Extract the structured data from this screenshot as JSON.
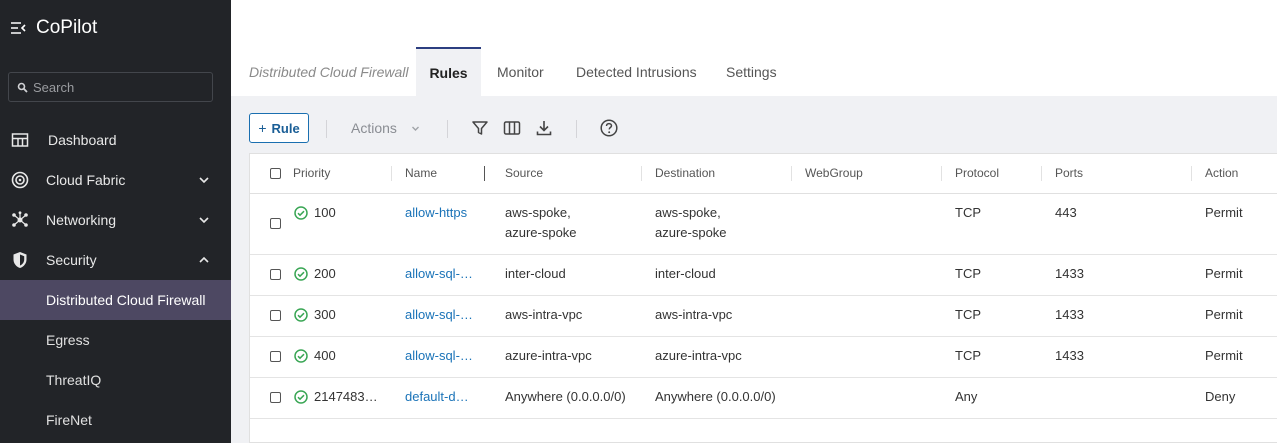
{
  "app": {
    "name": "CoPilot"
  },
  "search": {
    "placeholder": "Search"
  },
  "sidebar": {
    "items": [
      {
        "label": "Dashboard"
      },
      {
        "label": "Cloud Fabric"
      },
      {
        "label": "Networking"
      },
      {
        "label": "Security"
      }
    ],
    "security_sub": [
      {
        "label": "Distributed Cloud Firewall"
      },
      {
        "label": "Egress"
      },
      {
        "label": "ThreatIQ"
      },
      {
        "label": "FireNet"
      }
    ]
  },
  "tabs": {
    "breadcrumb": "Distributed Cloud Firewall",
    "items": [
      "Rules",
      "Monitor",
      "Detected Intrusions",
      "Settings"
    ],
    "active": "Rules"
  },
  "toolbar": {
    "rule_label": "Rule",
    "actions_label": "Actions",
    "icons": [
      "filter-icon",
      "columns-icon",
      "download-icon",
      "help-icon"
    ]
  },
  "table": {
    "headers": [
      "Priority",
      "Name",
      "Source",
      "Destination",
      "WebGroup",
      "Protocol",
      "Ports",
      "Action"
    ],
    "rows": [
      {
        "priority": "100",
        "name": "allow-https",
        "source": [
          "aws-spoke,",
          "azure-spoke"
        ],
        "destination": [
          "aws-spoke,",
          "azure-spoke"
        ],
        "webgroup": "",
        "protocol": "TCP",
        "ports": "443",
        "action": "Permit"
      },
      {
        "priority": "200",
        "name": "allow-sql-…",
        "source": [
          "inter-cloud"
        ],
        "destination": [
          "inter-cloud"
        ],
        "webgroup": "",
        "protocol": "TCP",
        "ports": "1433",
        "action": "Permit"
      },
      {
        "priority": "300",
        "name": "allow-sql-…",
        "source": [
          "aws-intra-vpc"
        ],
        "destination": [
          "aws-intra-vpc"
        ],
        "webgroup": "",
        "protocol": "TCP",
        "ports": "1433",
        "action": "Permit"
      },
      {
        "priority": "400",
        "name": "allow-sql-…",
        "source": [
          "azure-intra-vpc"
        ],
        "destination": [
          "azure-intra-vpc"
        ],
        "webgroup": "",
        "protocol": "TCP",
        "ports": "1433",
        "action": "Permit"
      },
      {
        "priority": "2147483…",
        "name": "default-d…",
        "source": [
          "Anywhere (0.0.0.0/0)"
        ],
        "destination": [
          "Anywhere (0.0.0.0/0)"
        ],
        "webgroup": "",
        "protocol": "Any",
        "ports": "",
        "action": "Deny"
      }
    ]
  },
  "colors": {
    "sidebar_bg": "#222428",
    "active_item_bg": "#4d4862",
    "link": "#1a73b8",
    "status_ok": "#3aa655",
    "rule_button": "#1a5e96"
  }
}
